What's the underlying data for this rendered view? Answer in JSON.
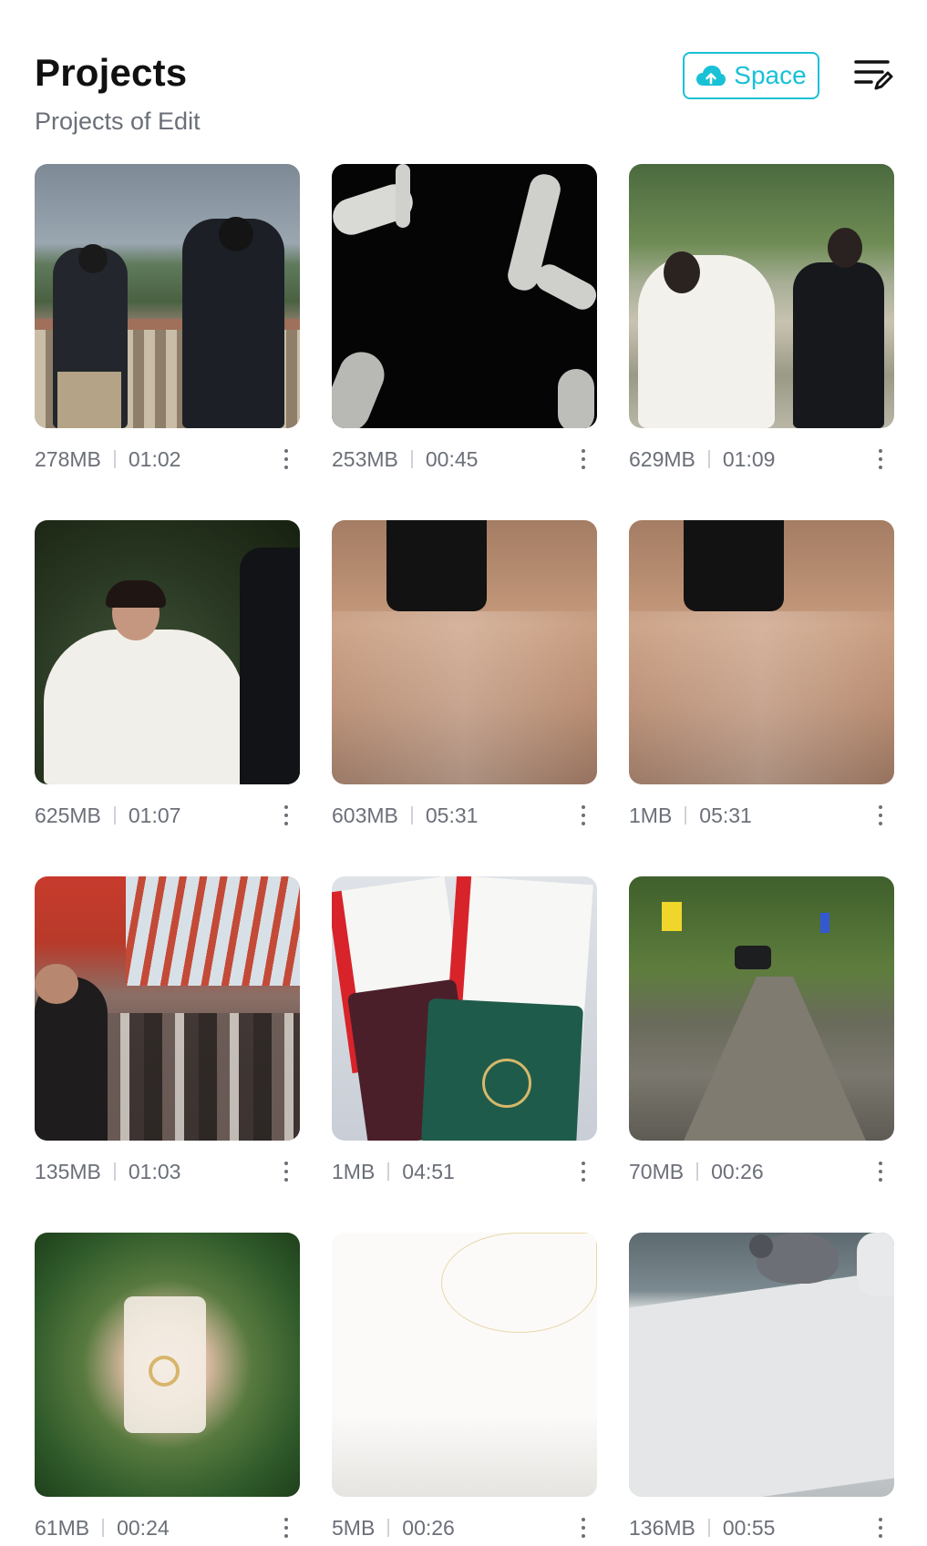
{
  "header": {
    "title": "Projects",
    "subtitle": "Projects of Edit",
    "space_button_label": "Space",
    "accent_color": "#19c1d6"
  },
  "icons": {
    "space_button_icon": "cloud-upload-icon",
    "top_right_icon": "list-edit-icon",
    "card_menu_icon": "more-vertical-icon"
  },
  "projects": [
    {
      "size": "278MB",
      "duration": "01:02"
    },
    {
      "size": "253MB",
      "duration": "00:45"
    },
    {
      "size": "629MB",
      "duration": "01:09"
    },
    {
      "size": "625MB",
      "duration": "01:07"
    },
    {
      "size": "603MB",
      "duration": "05:31"
    },
    {
      "size": "1MB",
      "duration": "05:31"
    },
    {
      "size": "135MB",
      "duration": "01:03"
    },
    {
      "size": "1MB",
      "duration": "04:51"
    },
    {
      "size": "70MB",
      "duration": "00:26"
    },
    {
      "size": "61MB",
      "duration": "00:24"
    },
    {
      "size": "5MB",
      "duration": "00:26"
    },
    {
      "size": "136MB",
      "duration": "00:55"
    }
  ]
}
